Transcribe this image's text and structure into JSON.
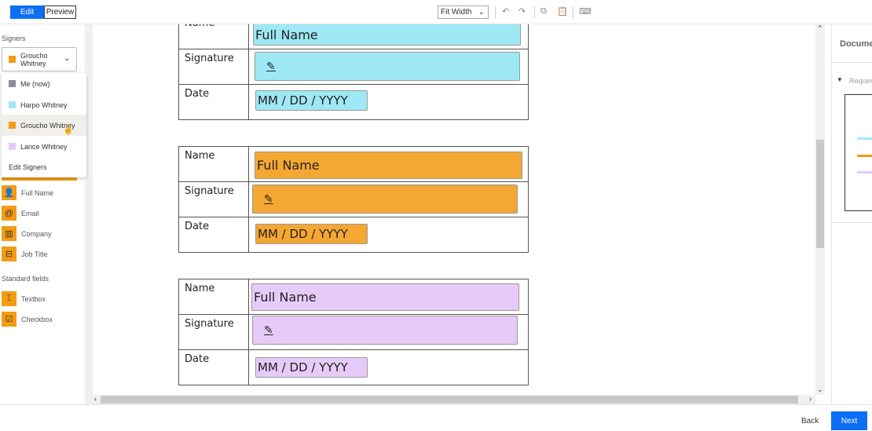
{
  "toolbar": {
    "edit": "Edit",
    "preview": "Preview",
    "zoom": "Fit Width"
  },
  "sidebar": {
    "signers_label": "Signers",
    "selected_signer": "Groucho Whitney",
    "menu": [
      {
        "label": "Me (now)",
        "color": "#8a9097"
      },
      {
        "label": "Harpo Whitney",
        "color": "#9ee6f5"
      },
      {
        "label": "Groucho Whitney",
        "color": "#f39c12"
      },
      {
        "label": "Lance Whitney",
        "color": "#e6c8f8"
      }
    ],
    "edit_signers": "Edit Signers",
    "fields": [
      {
        "label": "Full Name",
        "icon": "person-icon"
      },
      {
        "label": "Email",
        "icon": "at-icon"
      },
      {
        "label": "Company",
        "icon": "building-icon"
      },
      {
        "label": "Job Title",
        "icon": "briefcase-icon"
      }
    ],
    "standard_label": "Standard fields",
    "standard": [
      {
        "label": "Textbox",
        "icon": "textbox-icon"
      },
      {
        "label": "Checkbox",
        "icon": "checkbox-icon"
      }
    ]
  },
  "document": {
    "row_labels": {
      "name": "Name",
      "signature": "Signature",
      "date": "Date"
    },
    "name_placeholder": "Full Name",
    "date_placeholder": "MM / DD / YYYY",
    "blocks": [
      {
        "color": "#9ee8f5"
      },
      {
        "color": "#f5a733"
      },
      {
        "color": "#e6cbf8"
      }
    ]
  },
  "right_panel": {
    "title": "Docume",
    "section": "Reques"
  },
  "footer": {
    "back": "Back",
    "next": "Next"
  }
}
